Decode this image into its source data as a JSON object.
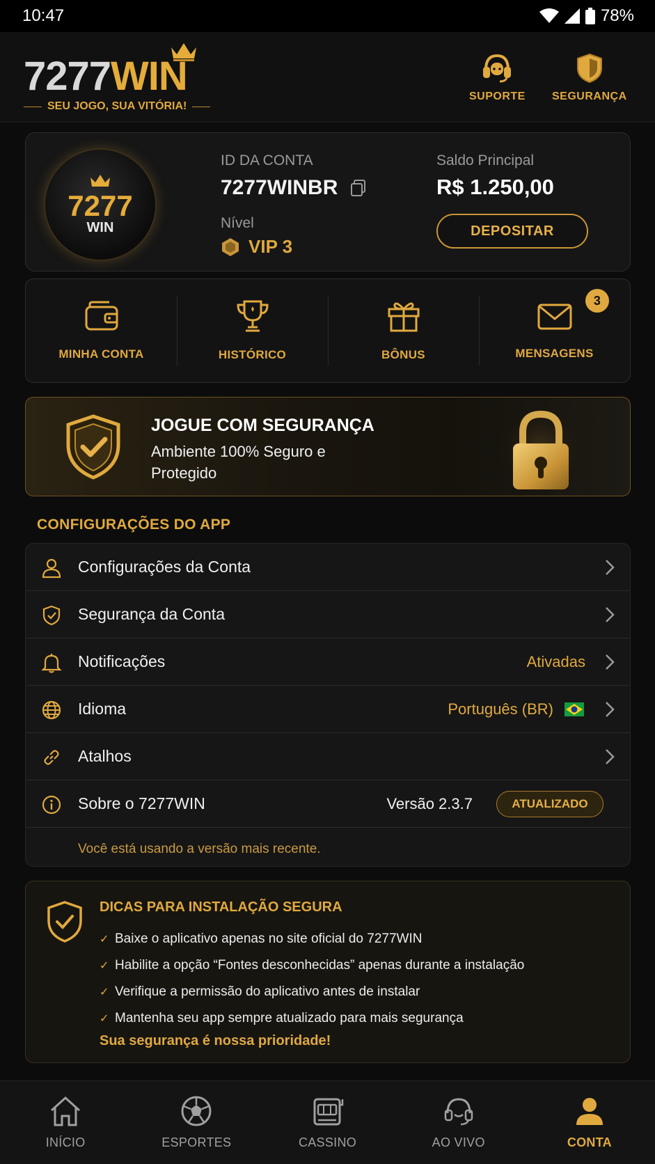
{
  "status_bar": {
    "time": "10:47",
    "battery": "78%"
  },
  "header": {
    "logo_part1": "7277",
    "logo_part2": "WIN",
    "tagline": "SEU JOGO, SUA VITÓRIA!",
    "support_label": "SUPORTE",
    "security_label": "SEGURANÇA"
  },
  "account": {
    "avatar_num": "7277",
    "avatar_win": "WIN",
    "id_label": "ID DA CONTA",
    "id_value": "7277WINBR",
    "level_label": "Nível",
    "level_value": "VIP 3",
    "balance_label": "Saldo Principal",
    "balance_value": "R$ 1.250,00",
    "deposit_label": "DEPOSITAR"
  },
  "quick_actions": [
    {
      "label": "MINHA CONTA",
      "icon": "wallet-icon"
    },
    {
      "label": "HISTÓRICO",
      "icon": "trophy-icon"
    },
    {
      "label": "BÔNUS",
      "icon": "gift-icon"
    },
    {
      "label": "MENSAGENS",
      "icon": "mail-icon",
      "badge": "3"
    }
  ],
  "security_banner": {
    "title": "JOGUE COM SEGURANÇA",
    "subtitle": "Ambiente 100% Seguro e Protegido"
  },
  "settings": {
    "section_title": "CONFIGURAÇÕES DO APP",
    "rows": [
      {
        "label": "Configurações da Conta",
        "icon": "user-icon"
      },
      {
        "label": "Segurança da Conta",
        "icon": "shield-check-icon"
      },
      {
        "label": "Notificações",
        "value": "Ativadas",
        "icon": "bell-icon"
      },
      {
        "label": "Idioma",
        "value": "Português (BR)",
        "icon": "globe-icon"
      },
      {
        "label": "Atalhos",
        "icon": "link-icon"
      },
      {
        "label": "Sobre o 7277WIN",
        "version": "Versão 2.3.7",
        "status": "ATUALIZADO",
        "icon": "info-icon"
      }
    ],
    "note": "Você está usando a versão mais recente."
  },
  "tips": {
    "title": "DICAS PARA INSTALAÇÃO SEGURA",
    "items": [
      "Baixe o aplicativo apenas no site oficial do 7277WIN",
      "Habilite a opção “Fontes desconhecidas” apenas durante a instalação",
      "Verifique a permissão do aplicativo antes de instalar",
      "Mantenha seu app sempre atualizado para mais segurança"
    ],
    "footer": "Sua segurança é nossa prioridade!"
  },
  "bottom_nav": [
    {
      "label": "INÍCIO",
      "icon": "home-icon"
    },
    {
      "label": "ESPORTES",
      "icon": "soccer-ball-icon"
    },
    {
      "label": "CASSINO",
      "icon": "slot-machine-icon"
    },
    {
      "label": "AO VIVO",
      "icon": "headset-icon"
    },
    {
      "label": "CONTA",
      "icon": "user-icon",
      "active": true
    }
  ],
  "colors": {
    "accent": "#e0a93f",
    "background": "#0c0c0c",
    "card": "#161616"
  }
}
